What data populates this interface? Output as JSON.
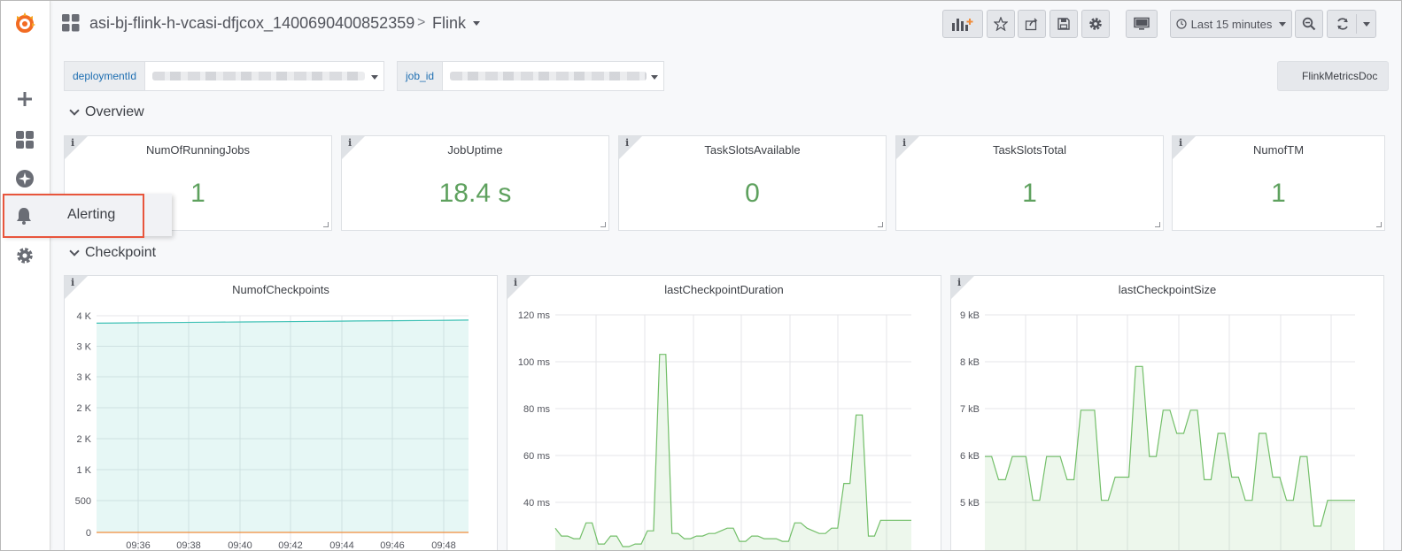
{
  "breadcrumb": {
    "folder": "asi-bj-flink-h-vcasi-dfjcox_1400690400852359",
    "separator": ">",
    "dashboard": "Flink"
  },
  "sidebar": {
    "flyout_label": "Alerting",
    "icons": [
      "grafana-logo-icon",
      "plus-icon",
      "dashboards-icon",
      "explore-icon",
      "bell-icon",
      "gear-icon"
    ]
  },
  "toolbar": {
    "time_range": "Last 15 minutes",
    "icons": [
      "add-panel-icon",
      "star-icon",
      "share-icon",
      "save-icon",
      "settings-icon",
      "tv-icon",
      "clock-icon",
      "zoom-out-icon",
      "refresh-icon"
    ]
  },
  "variables": [
    {
      "label": "deploymentId"
    },
    {
      "label": "job_id"
    }
  ],
  "docs_link": "FlinkMetricsDoc",
  "rows": {
    "overview": "Overview",
    "checkpoint": "Checkpoint"
  },
  "stats": [
    {
      "title": "NumOfRunningJobs",
      "value": "1"
    },
    {
      "title": "JobUptime",
      "value": "18.4 s"
    },
    {
      "title": "TaskSlotsAvailable",
      "value": "0"
    },
    {
      "title": "TaskSlotsTotal",
      "value": "1"
    },
    {
      "title": "NumofTM",
      "value": "1"
    }
  ],
  "colors": {
    "stat_green": "#5ea15e",
    "series_teal": "#3fc1b5",
    "series_orange": "#f08c3a",
    "series_green": "#73bf69",
    "highlight": "#e8553c"
  },
  "chart_data": [
    {
      "type": "area",
      "title": "NumofCheckpoints",
      "y_ticks": [
        "4 K",
        "3 K",
        "3 K",
        "2 K",
        "2 K",
        "1 K",
        "500",
        "0"
      ],
      "x_ticks": [
        "09:36",
        "09:38",
        "09:40",
        "09:42",
        "09:44",
        "09:46",
        "09:48"
      ],
      "ylim": [
        0,
        3500
      ],
      "series": [
        {
          "values": [
            3380,
            3385,
            3390,
            3395,
            3400,
            3405,
            3410,
            3415,
            3420,
            3425,
            3430
          ],
          "color": "#3fc1b5"
        },
        {
          "values": [
            0,
            0,
            0,
            0,
            0,
            0,
            0,
            0,
            0,
            0,
            0
          ],
          "color": "#f08c3a"
        }
      ]
    },
    {
      "type": "area",
      "title": "lastCheckpointDuration",
      "y_ticks": [
        "120 ms",
        "100 ms",
        "80 ms",
        "60 ms",
        "40 ms"
      ],
      "ylim": [
        30,
        120
      ],
      "series": [
        {
          "values": [
            39,
            36,
            36,
            35,
            35,
            41,
            41,
            33,
            33,
            36,
            36,
            32,
            32,
            33,
            33,
            38,
            38,
            105,
            105,
            37,
            37,
            35,
            35,
            36,
            36,
            37,
            37,
            38,
            39,
            39,
            34,
            34,
            36,
            36,
            35,
            35,
            35,
            34,
            34,
            41,
            41,
            39,
            38,
            37,
            37,
            39,
            39,
            56,
            56,
            82,
            82,
            36,
            36,
            42,
            42,
            42,
            42,
            42,
            42
          ],
          "color": "#73bf69"
        }
      ]
    },
    {
      "type": "area",
      "title": "lastCheckpointSize",
      "y_ticks": [
        "9 kB",
        "8 kB",
        "7 kB",
        "6 kB",
        "5 kB"
      ],
      "ylim": [
        4400,
        9000
      ],
      "series": [
        {
          "values": [
            6250,
            6250,
            5800,
            5800,
            6250,
            6250,
            6250,
            5400,
            5400,
            6250,
            6250,
            6250,
            5800,
            5800,
            7150,
            7150,
            7150,
            5400,
            5400,
            5850,
            5850,
            5850,
            8000,
            8000,
            6250,
            6250,
            7150,
            7150,
            6700,
            6700,
            7150,
            7150,
            5800,
            5800,
            6700,
            6700,
            5850,
            5850,
            5400,
            5400,
            6700,
            6700,
            5850,
            5850,
            5400,
            5400,
            6250,
            6250,
            4900,
            4900,
            5400,
            5400,
            5400,
            5400,
            5400
          ],
          "color": "#73bf69"
        }
      ]
    }
  ]
}
